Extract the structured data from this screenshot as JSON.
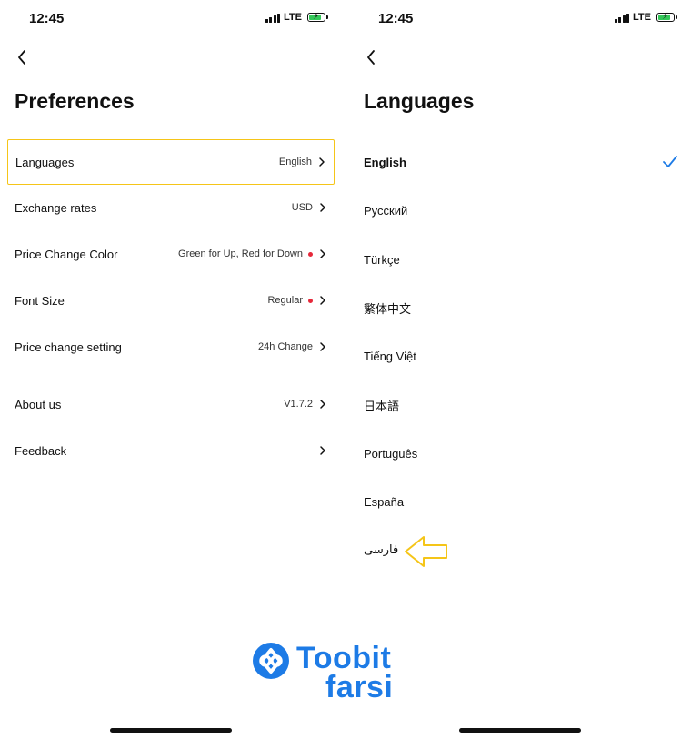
{
  "left_screen": {
    "status": {
      "time": "12:45",
      "network": "LTE"
    },
    "title": "Preferences",
    "rows": [
      {
        "label": "Languages",
        "value": "English",
        "dot": false,
        "highlighted": true
      },
      {
        "label": "Exchange rates",
        "value": "USD",
        "dot": false,
        "highlighted": false
      },
      {
        "label": "Price Change Color",
        "value": "Green for Up, Red for Down",
        "dot": true,
        "highlighted": false
      },
      {
        "label": "Font Size",
        "value": "Regular",
        "dot": true,
        "highlighted": false
      },
      {
        "label": "Price change setting",
        "value": "24h Change",
        "dot": false,
        "highlighted": false
      },
      {
        "label": "About us",
        "value": "V1.7.2",
        "dot": false,
        "highlighted": false
      },
      {
        "label": "Feedback",
        "value": "",
        "dot": false,
        "highlighted": false
      }
    ]
  },
  "right_screen": {
    "status": {
      "time": "12:45",
      "network": "LTE"
    },
    "title": "Languages",
    "languages": [
      {
        "label": "English",
        "selected": true
      },
      {
        "label": "Русский",
        "selected": false
      },
      {
        "label": "Türkçe",
        "selected": false
      },
      {
        "label": "繁体中文",
        "selected": false
      },
      {
        "label": "Tiếng Việt",
        "selected": false
      },
      {
        "label": "日本語",
        "selected": false
      },
      {
        "label": "Português",
        "selected": false
      },
      {
        "label": "España",
        "selected": false
      },
      {
        "label": "فارسی",
        "selected": false
      }
    ]
  },
  "watermark": {
    "line1": "Toobit",
    "line2": "farsi"
  },
  "colors": {
    "highlight_border": "#f5c518",
    "accent_blue": "#1d7be6",
    "red_dot": "#e6283a",
    "battery_green": "#34c759",
    "arrow_annotation": "#f5c518"
  },
  "icons": {
    "back": "chevron-left-icon",
    "row_chevron": "chevron-right-icon",
    "selected": "checkmark-icon",
    "annotation": "arrow-left-icon"
  }
}
